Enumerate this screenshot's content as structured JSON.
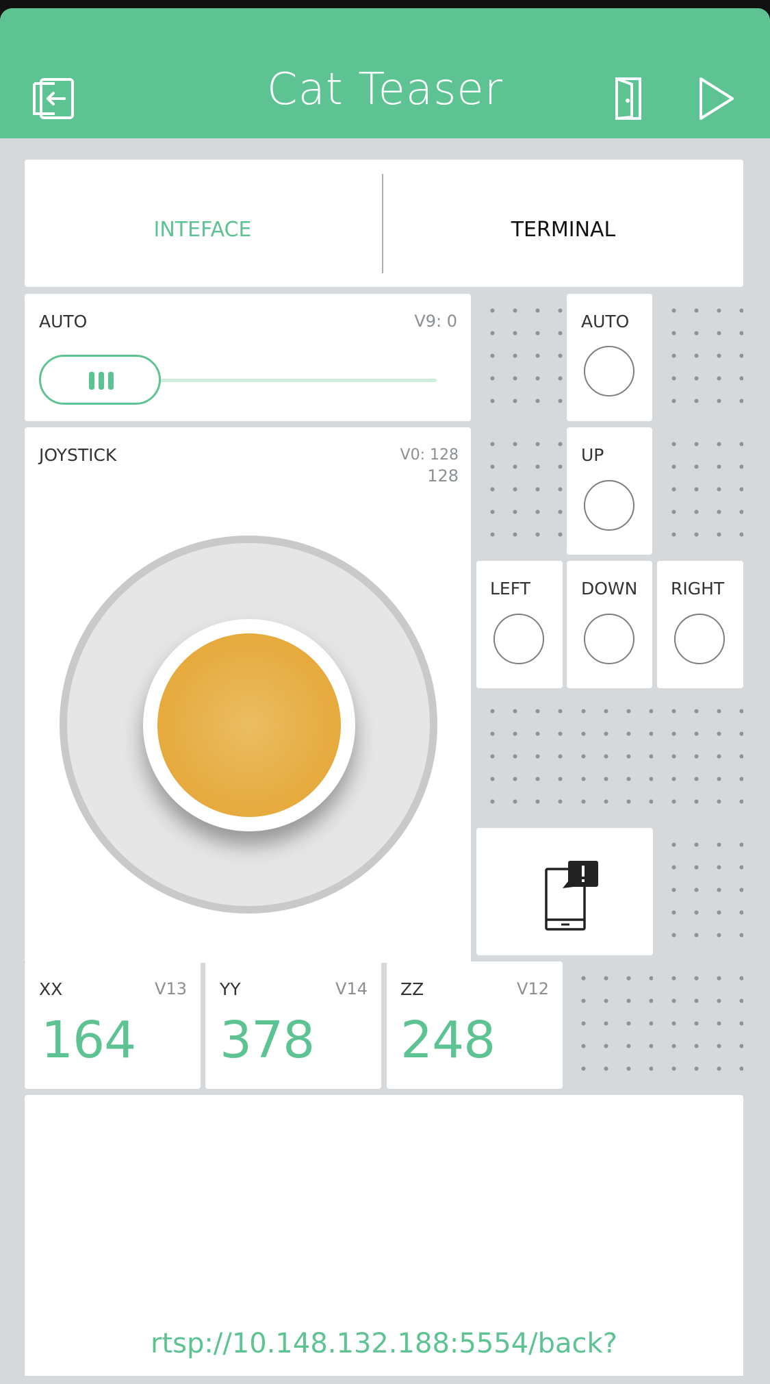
{
  "header": {
    "title": "Cat Teaser",
    "left_icon": "exit-icon",
    "right_icons": [
      "device-door-icon",
      "play-icon"
    ]
  },
  "tabs": [
    {
      "label": "INTEFACE",
      "active": true
    },
    {
      "label": "TERMINAL",
      "active": false
    }
  ],
  "slider": {
    "label": "AUTO",
    "pin": "V9: 0",
    "level": 0
  },
  "auto_button": {
    "label": "AUTO"
  },
  "joystick": {
    "label": "JOYSTICK",
    "pin_line1": "V0: 128",
    "pin_line2": "128"
  },
  "buttons": {
    "up": "UP",
    "left": "LEFT",
    "down": "DOWN",
    "right": "RIGHT"
  },
  "notification_widget": {
    "icon": "phone-notification-icon"
  },
  "displays": [
    {
      "label": "XX",
      "pin": "V13",
      "value": "164"
    },
    {
      "label": "YY",
      "pin": "V14",
      "value": "378"
    },
    {
      "label": "ZZ",
      "pin": "V12",
      "value": "248"
    }
  ],
  "video": {
    "url": "rtsp://10.148.132.188:5554/back?"
  },
  "colors": {
    "accent": "#5ec392",
    "joystick_knob": "#e5a83a",
    "background": "#d6d9dc"
  }
}
